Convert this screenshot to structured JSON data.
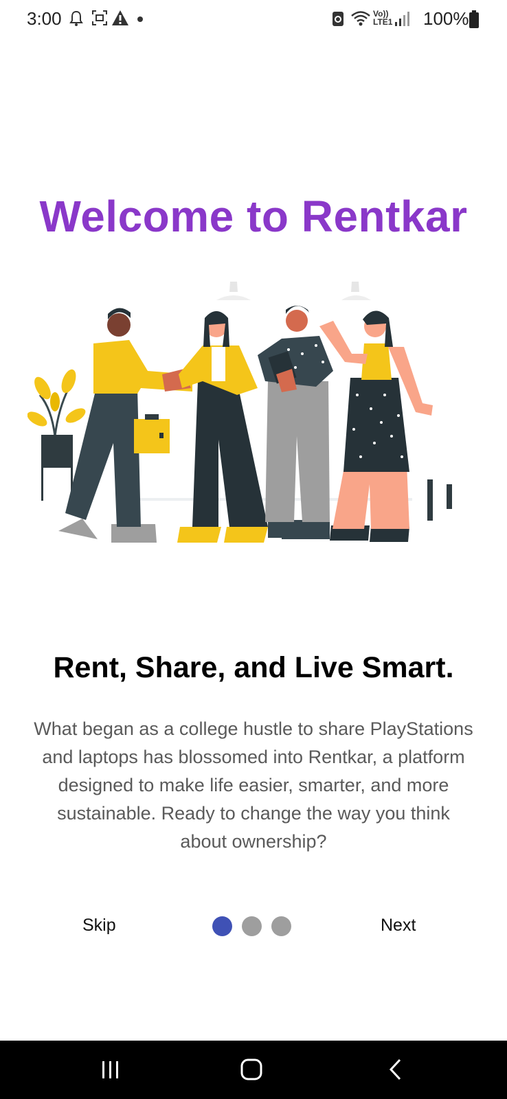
{
  "status_bar": {
    "time": "3:00",
    "battery": "100%",
    "left_icons": [
      "bell-icon",
      "screenshot-icon",
      "warning-icon",
      "dot-icon"
    ],
    "right_icons": [
      "data-saver-icon",
      "wifi-icon",
      "volte-icon",
      "signal-icon",
      "battery-icon"
    ],
    "volte_label_top": "Vo))",
    "volte_label_bottom": "LTE1"
  },
  "onboarding": {
    "title": "Welcome to Rentkar",
    "subtitle": "Rent, Share, and Live Smart.",
    "description": "What began as a college hustle to share PlayStations and laptops has blossomed into Rentkar, a platform designed to make life easier, smarter, and more sustainable. Ready to change the way you think about ownership?",
    "skip_label": "Skip",
    "next_label": "Next",
    "page_indicator": {
      "total": 3,
      "current": 1
    },
    "colors": {
      "title": "#8a38c9",
      "active_dot": "#3f51b5",
      "inactive_dot": "#9e9e9e"
    }
  },
  "nav_bar": {
    "icons": [
      "recents-icon",
      "home-icon",
      "back-icon"
    ]
  }
}
